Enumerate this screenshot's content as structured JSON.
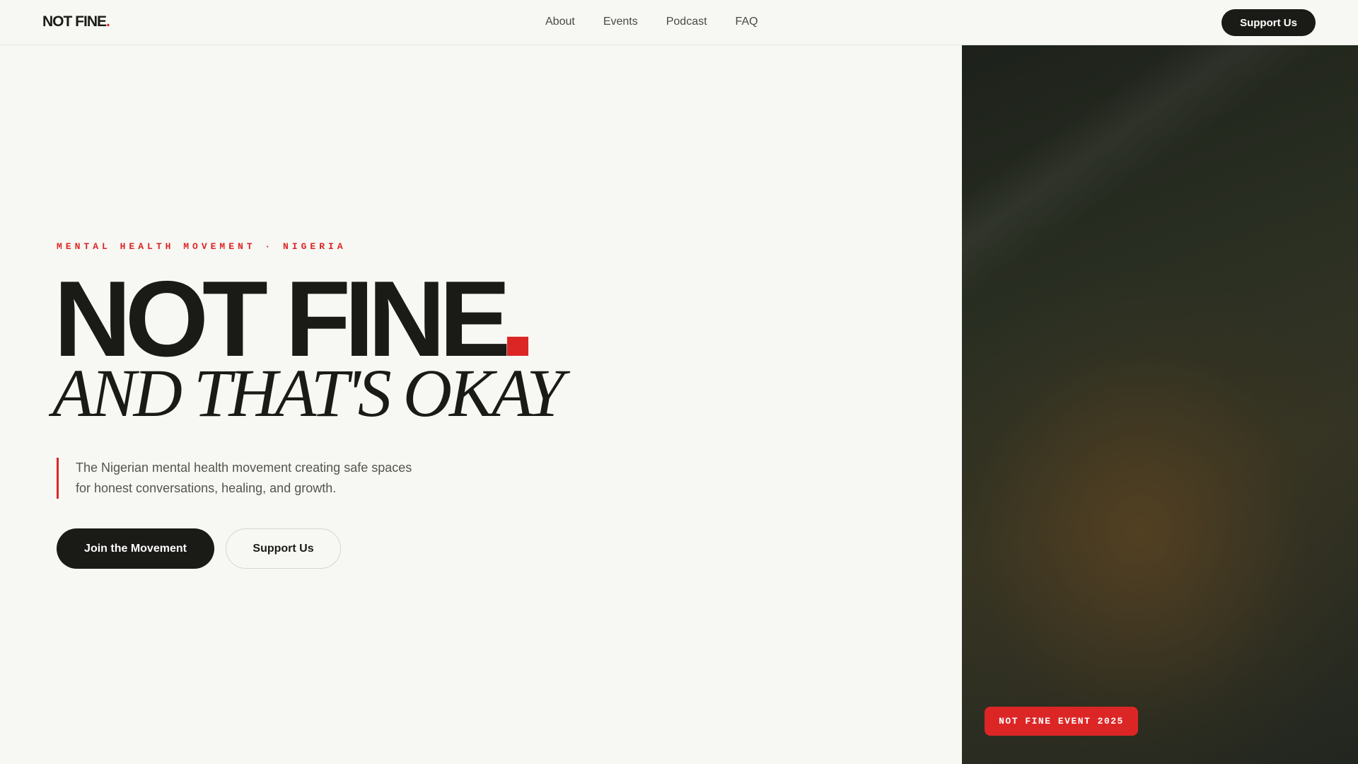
{
  "nav": {
    "logo_text": "NOT FINE",
    "logo_dot": ".",
    "links": [
      "About",
      "Events",
      "Podcast",
      "FAQ"
    ],
    "cta_label": "Support Us"
  },
  "hero": {
    "eyebrow": "MENTAL HEALTH MOVEMENT · NIGERIA",
    "title": "NOT FINE",
    "subtitle": "AND THAT'S OKAY",
    "description": "The Nigerian mental health movement creating safe spaces for honest conversations, healing, and growth.",
    "primary_button": "Join the Movement",
    "secondary_button": "Support Us"
  },
  "photo": {
    "badge": "NOT FINE EVENT 2025"
  },
  "colors": {
    "accent": "#dc2626",
    "ink": "#1a1a17",
    "background": "#f7f7f3"
  }
}
